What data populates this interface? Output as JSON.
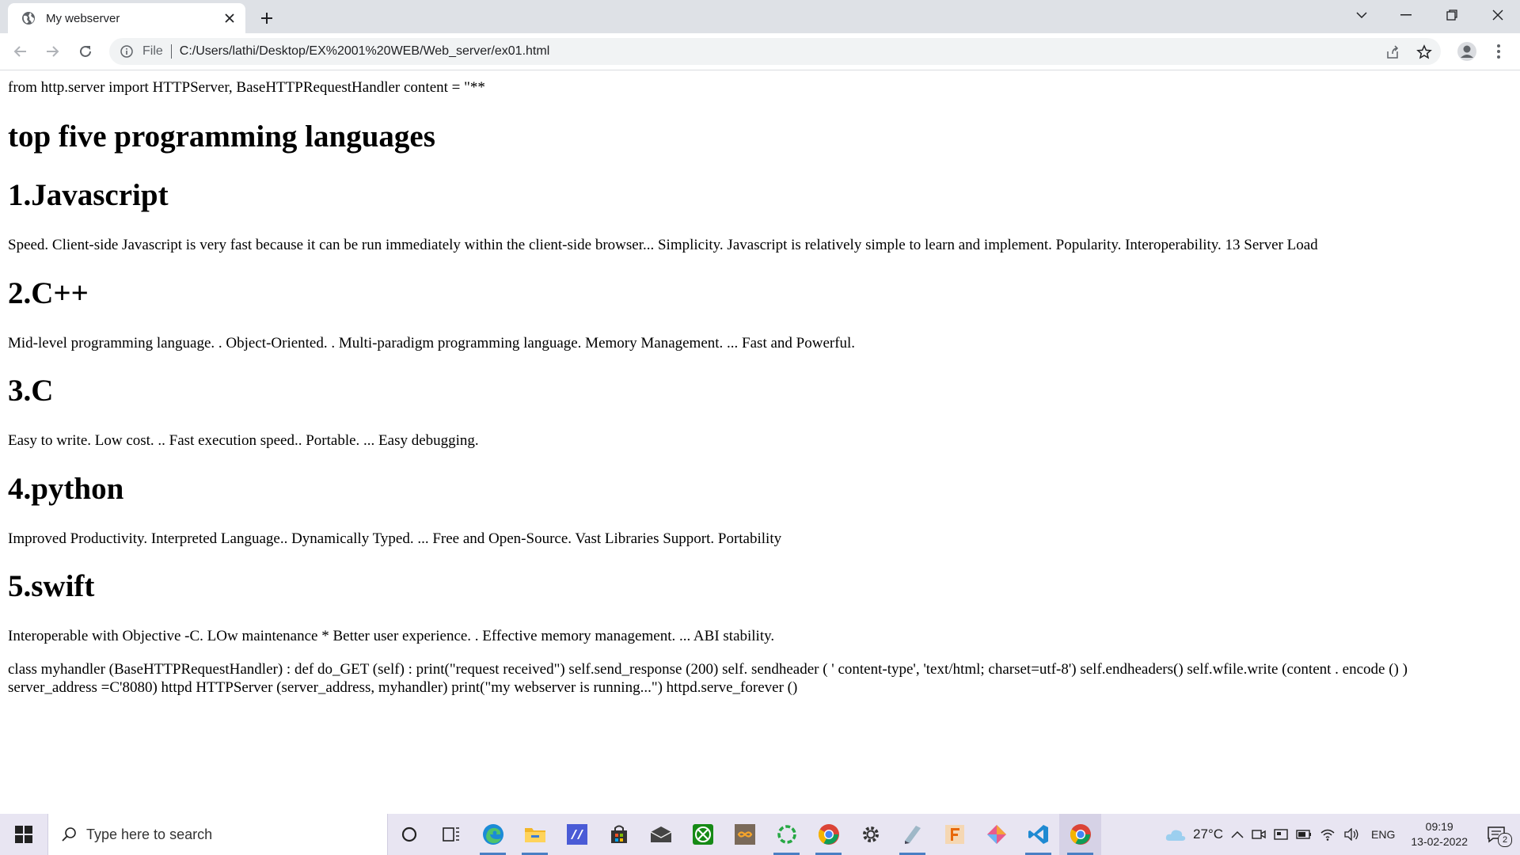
{
  "browser": {
    "tab_title": "My webserver",
    "url_scheme": "File",
    "url": "C:/Users/lathi/Desktop/EX%2001%20WEB/Web_server/ex01.html"
  },
  "page": {
    "intro": "from http.server import HTTPServer, BaseHTTPRequestHandler content = \"**",
    "heading": "top five programming languages",
    "languages": [
      {
        "title": "1.Javascript",
        "text": "Speed. Client-side Javascript is very fast because it can be run immediately within the client-side browser... Simplicity. Javascript is relatively simple to learn and implement. Popularity. Interoperability. 13 Server Load"
      },
      {
        "title": "2.C++",
        "text": "Mid-level programming language. . Object-Oriented. . Multi-paradigm programming language. Memory Management. ... Fast and Powerful."
      },
      {
        "title": "3.C",
        "text": "Easy to write. Low cost. .. Fast execution speed.. Portable. ... Easy debugging."
      },
      {
        "title": "4.python",
        "text": "Improved Productivity. Interpreted Language.. Dynamically Typed. ... Free and Open-Source. Vast Libraries Support. Portability"
      },
      {
        "title": "5.swift",
        "text": "Interoperable with Objective -C. LOw maintenance * Better user experience. . Effective memory management. ... ABI stability."
      }
    ],
    "code": "class myhandler (BaseHTTPRequestHandler) : def do_GET (self) : print(\"request received\") self.send_response (200) self. sendheader ( ' content-type', 'text/html; charset=utf-8') self.endheaders() self.wfile.write (content . encode () ) server_address =C'8080) httpd HTTPServer (server_address, myhandler) print(\"my webserver is running...\") httpd.serve_forever ()"
  },
  "taskbar": {
    "search_placeholder": "Type here to search",
    "weather": "27°C",
    "language": "ENG",
    "time": "09:19",
    "date": "13-02-2022",
    "notification_count": "2",
    "icons": [
      "cortana-icon",
      "task-view-icon",
      "edge-icon",
      "file-explorer-icon",
      "visual-studio-icon",
      "store-icon",
      "mail-icon",
      "xbox-icon",
      "infinity-app-icon",
      "spinner-app-icon",
      "chrome-icon",
      "settings-icon",
      "notepad-icon",
      "f-app-icon",
      "git-icon",
      "vscode-icon",
      "chrome-active-icon"
    ]
  },
  "colors": {
    "tabstrip": "#dee1e6",
    "taskbar": "#e8e5f2",
    "active_underline": "#4a7fc4"
  }
}
